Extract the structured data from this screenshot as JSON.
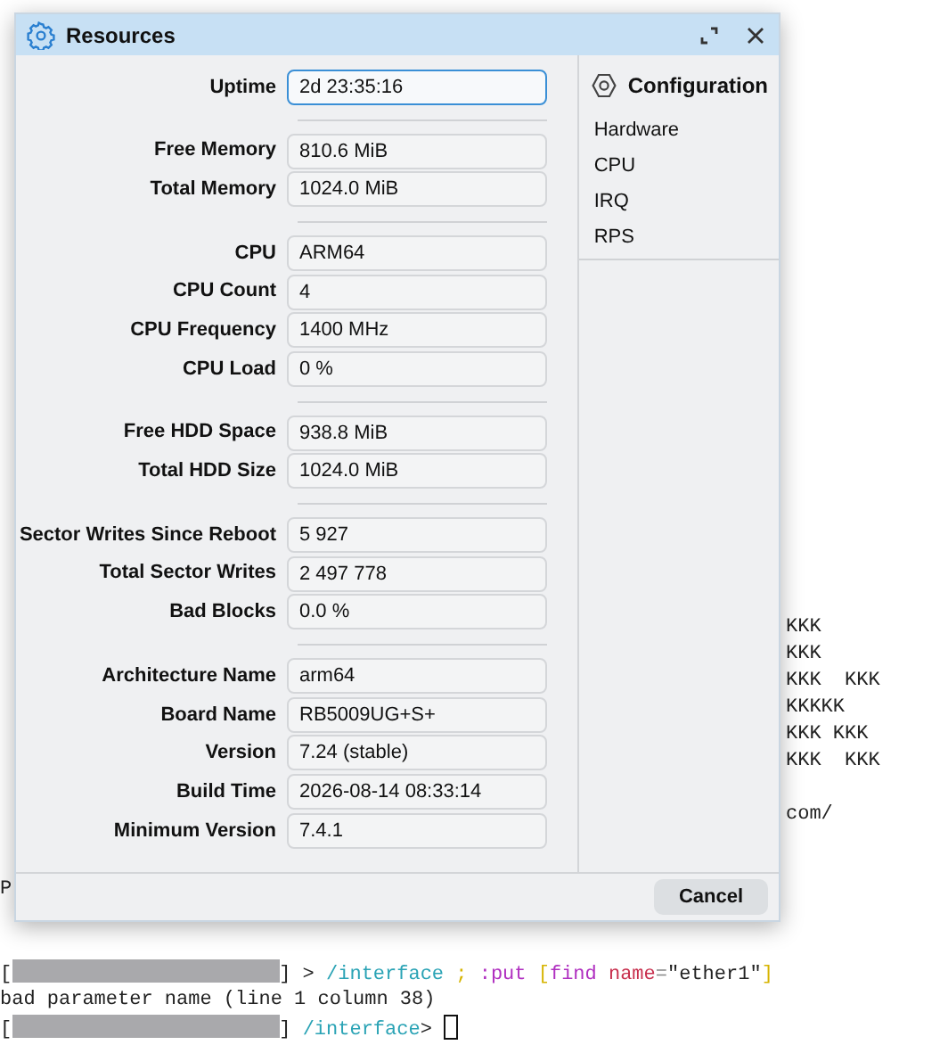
{
  "window": {
    "title": "Resources"
  },
  "sections": [
    {
      "fields": [
        {
          "label": "Uptime",
          "value": "2d 23:35:16",
          "focused": true
        }
      ]
    },
    {
      "fields": [
        {
          "label": "Free Memory",
          "value": "810.6 MiB",
          "focused": false
        },
        {
          "label": "Total Memory",
          "value": "1024.0 MiB",
          "focused": false
        }
      ]
    },
    {
      "fields": [
        {
          "label": "CPU",
          "value": "ARM64",
          "focused": false
        },
        {
          "label": "CPU Count",
          "value": "4",
          "focused": false
        },
        {
          "label": "CPU Frequency",
          "value": "1400 MHz",
          "focused": false
        },
        {
          "label": "CPU Load",
          "value": "0 %",
          "focused": false
        }
      ]
    },
    {
      "fields": [
        {
          "label": "Free HDD Space",
          "value": "938.8 MiB",
          "focused": false
        },
        {
          "label": "Total HDD Size",
          "value": "1024.0 MiB",
          "focused": false
        }
      ]
    },
    {
      "fields": [
        {
          "label": "Sector Writes Since Reboot",
          "value": "5 927",
          "focused": false
        },
        {
          "label": "Total Sector Writes",
          "value": "2 497 778",
          "focused": false
        },
        {
          "label": "Bad Blocks",
          "value": "0.0 %",
          "focused": false
        }
      ]
    },
    {
      "fields": [
        {
          "label": "Architecture Name",
          "value": "arm64",
          "focused": false
        },
        {
          "label": "Board Name",
          "value": "RB5009UG+S+",
          "focused": false
        },
        {
          "label": "Version",
          "value": "7.24 (stable)",
          "focused": false
        },
        {
          "label": "Build Time",
          "value": "2026-08-14 08:33:14",
          "focused": false
        },
        {
          "label": "Minimum Version",
          "value": "7.4.1",
          "focused": false
        }
      ]
    }
  ],
  "sidebar": {
    "title": "Configuration",
    "items": [
      "Hardware",
      "CPU",
      "IRQ",
      "RPS"
    ]
  },
  "footer": {
    "buttons": [
      "Cancel"
    ]
  },
  "terminal": {
    "right_lines": [
      "KKK",
      "KKK",
      "KKK  KKK",
      "KKKKK",
      "KKK KKK",
      "KKK  KKK"
    ],
    "right_fragment": "com/",
    "left_fragment": "P",
    "lines": [
      [
        {
          "kind": "text",
          "text": "["
        },
        {
          "kind": "redacted"
        },
        {
          "kind": "text",
          "text": "] > "
        },
        {
          "kind": "text",
          "text": "/interface",
          "color": "#2aa3b5"
        },
        {
          "kind": "text",
          "text": " ; ",
          "color": "#d6b400"
        },
        {
          "kind": "text",
          "text": ":put ",
          "color": "#b02fc0"
        },
        {
          "kind": "text",
          "text": "[",
          "color": "#d6b400"
        },
        {
          "kind": "text",
          "text": "find ",
          "color": "#b02fc0"
        },
        {
          "kind": "text",
          "text": "name",
          "color": "#c8304e"
        },
        {
          "kind": "text",
          "text": "=",
          "color": "#888888"
        },
        {
          "kind": "text",
          "text": "\"ether1\""
        },
        {
          "kind": "text",
          "text": "]",
          "color": "#d6b400"
        }
      ],
      [
        {
          "kind": "text",
          "text": "bad parameter name (line 1 column 38)"
        }
      ],
      [
        {
          "kind": "text",
          "text": "["
        },
        {
          "kind": "redacted"
        },
        {
          "kind": "text",
          "text": "] "
        },
        {
          "kind": "text",
          "text": "/interface",
          "color": "#2aa3b5"
        },
        {
          "kind": "text",
          "text": "> "
        },
        {
          "kind": "cursor"
        }
      ]
    ]
  }
}
